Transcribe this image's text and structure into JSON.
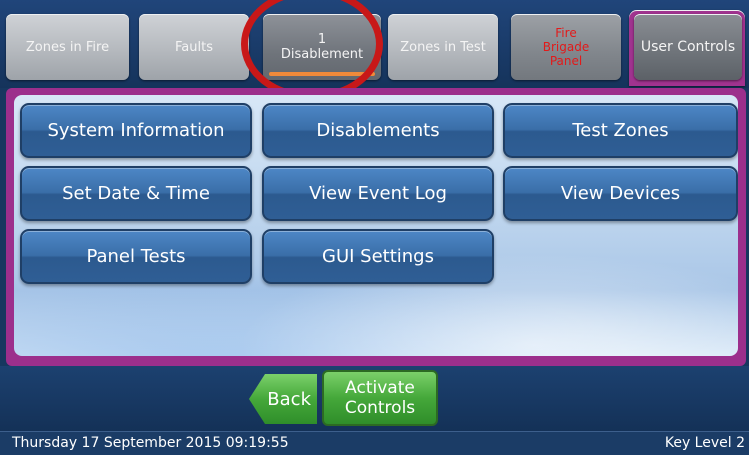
{
  "tabs": {
    "zones_in_fire": "Zones in Fire",
    "faults": "Faults",
    "disablement_count": "1",
    "disablement_label": "Disablement",
    "zones_in_test": "Zones in Test",
    "fire_brigade_line1": "Fire",
    "fire_brigade_line2": "Brigade",
    "fire_brigade_line3": "Panel",
    "user_controls": "User Controls"
  },
  "menu": {
    "system_information": "System Information",
    "disablements": "Disablements",
    "test_zones": "Test Zones",
    "set_date_time": "Set Date & Time",
    "view_event_log": "View Event Log",
    "view_devices": "View Devices",
    "panel_tests": "Panel Tests",
    "gui_settings": "GUI Settings"
  },
  "bottom": {
    "back": "Back",
    "activate_line1": "Activate",
    "activate_line2": "Controls"
  },
  "status": {
    "datetime": "Thursday 17 September 2015 09:19:55",
    "key_level": "Key Level 2"
  },
  "colors": {
    "accent_purple": "#9c2f8c",
    "button_blue": "#3a6ea8",
    "fire_red": "#e21a1a",
    "active_green": "#45a83a",
    "highlight_red": "#c81818"
  }
}
